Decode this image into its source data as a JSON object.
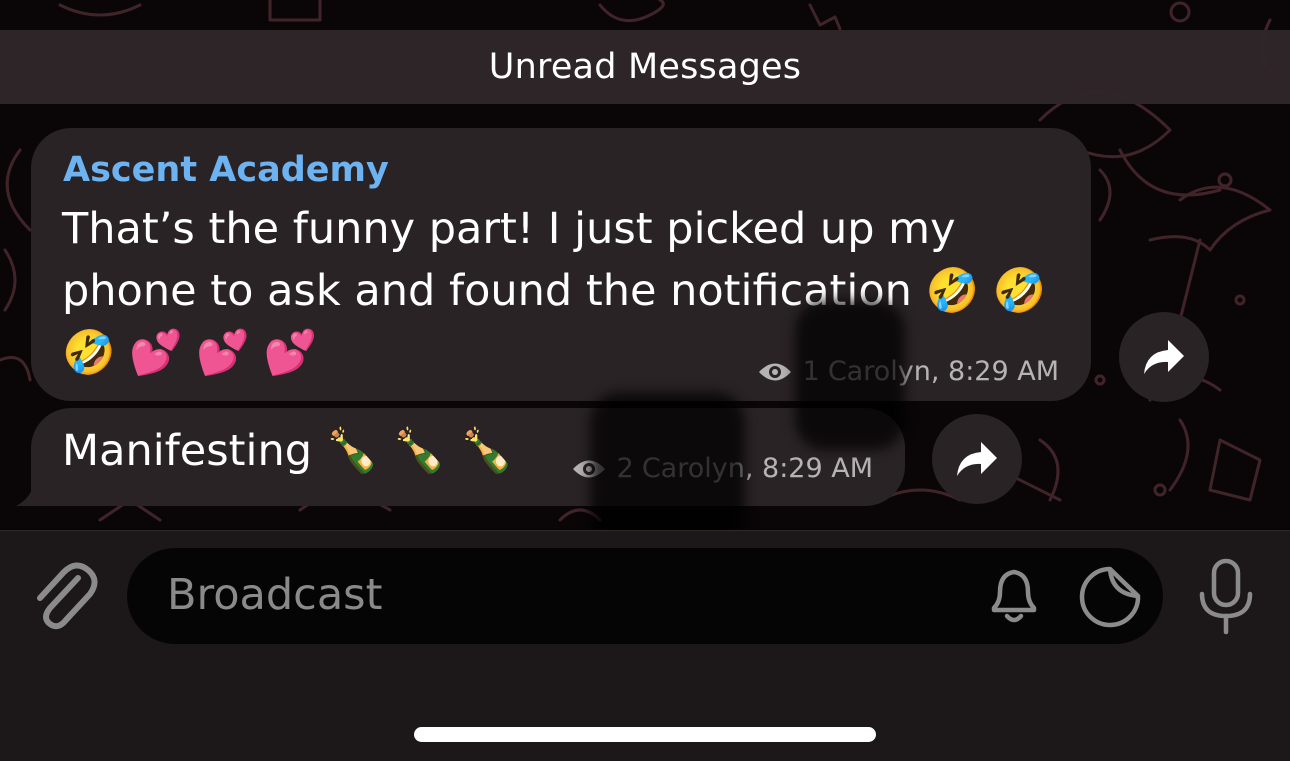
{
  "unread_banner": {
    "label": "Unread Messages"
  },
  "messages": [
    {
      "sender": "Ascent Academy",
      "text": "That’s the funny part! I just picked up my phone to ask and found the notification 🤣 🤣 🤣 💕 💕 💕",
      "views": "1",
      "author": "Carolyn",
      "time": "8:29 AM",
      "signature": "Carolyn, 8:29 AM"
    },
    {
      "text": "Manifesting 🍾 🍾 🍾",
      "views": "2",
      "author": "Carolyn",
      "time": "8:29 AM",
      "signature": "Carolyn, 8:29 AM"
    }
  ],
  "composer": {
    "placeholder": "Broadcast"
  },
  "icons": {
    "attach": "paperclip-icon",
    "notify": "bell-icon",
    "sticker": "sticker-icon",
    "voice": "microphone-icon",
    "views": "eye-icon",
    "share": "share-arrow-icon"
  },
  "colors": {
    "sender_name": "#6db3f2",
    "bubble": "#2a2325",
    "banner": "#30262a"
  }
}
